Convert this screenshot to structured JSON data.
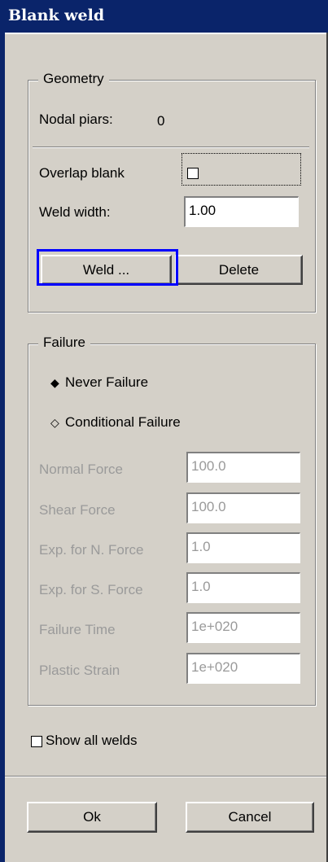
{
  "window": {
    "title": "Blank weld"
  },
  "geometry": {
    "legend": "Geometry",
    "nodal_pairs_label": "Nodal piars:",
    "nodal_pairs_value": "0",
    "overlap_label": "Overlap blank",
    "overlap_checked": false,
    "weld_width_label": "Weld width:",
    "weld_width_value": "1.00",
    "weld_button": "Weld ...",
    "delete_button": "Delete"
  },
  "failure": {
    "legend": "Failure",
    "never_label": "Never Failure",
    "never_icon": "◆",
    "conditional_label": "Conditional Failure",
    "conditional_icon": "◇",
    "selected": "Never Failure",
    "rows": [
      {
        "label": "Normal Force",
        "value": "100.0"
      },
      {
        "label": "Shear Force",
        "value": "100.0"
      },
      {
        "label": "Exp. for N. Force",
        "value": "1.0"
      },
      {
        "label": "Exp. for S. Force",
        "value": "1.0"
      },
      {
        "label": "Failure Time",
        "value": "1e+020"
      },
      {
        "label": "Plastic Strain",
        "value": "1e+020"
      }
    ]
  },
  "show_all_welds": {
    "label": "Show all welds",
    "checked": false
  },
  "footer": {
    "ok": "Ok",
    "cancel": "Cancel"
  },
  "colors": {
    "titlebar": "#0a246a",
    "face": "#d4d0c8",
    "highlight": "#0000ff"
  }
}
